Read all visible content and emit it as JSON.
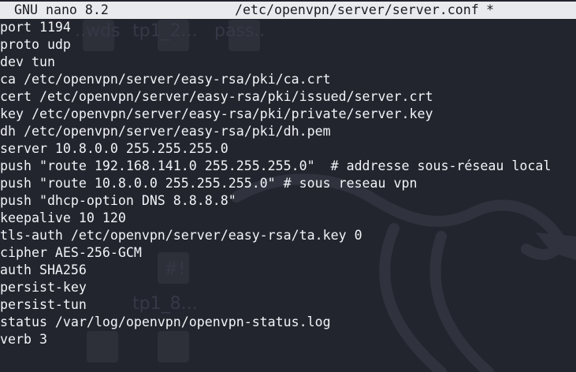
{
  "titlebar": {
    "app": "GNU nano 8.2",
    "file_path": "/etc/openvpn/server/server.conf",
    "modified_flag": "*"
  },
  "background_watermark": {
    "labels": [
      "..wds",
      "tp1_2...",
      "pass..",
      "tp1_8...",
      "#!"
    ],
    "art": "kali-dragon-icon"
  },
  "editor": {
    "lines": [
      "port 1194",
      "proto udp",
      "dev tun",
      "ca /etc/openvpn/server/easy-rsa/pki/ca.crt",
      "cert /etc/openvpn/server/easy-rsa/pki/issued/server.crt",
      "key /etc/openvpn/server/easy-rsa/pki/private/server.key",
      "dh /etc/openvpn/server/easy-rsa/pki/dh.pem",
      "server 10.8.0.0 255.255.255.0",
      "push \"route 192.168.141.0 255.255.255.0\"  # addresse sous-réseau local",
      "push \"route 10.8.0.0 255.255.255.0\" # sous reseau vpn",
      "push \"dhcp-option DNS 8.8.8.8\"",
      "keepalive 10 120",
      "tls-auth /etc/openvpn/server/easy-rsa/ta.key 0",
      "cipher AES-256-GCM",
      "auth SHA256",
      "persist-key",
      "persist-tun",
      "status /var/log/openvpn/openvpn-status.log",
      "verb 3"
    ]
  },
  "colors": {
    "background": "#23252e",
    "titlebar_bg": "#e9eaee",
    "titlebar_fg": "#1b1c22",
    "text": "#f2f4f8",
    "watermark": "#363a46"
  }
}
